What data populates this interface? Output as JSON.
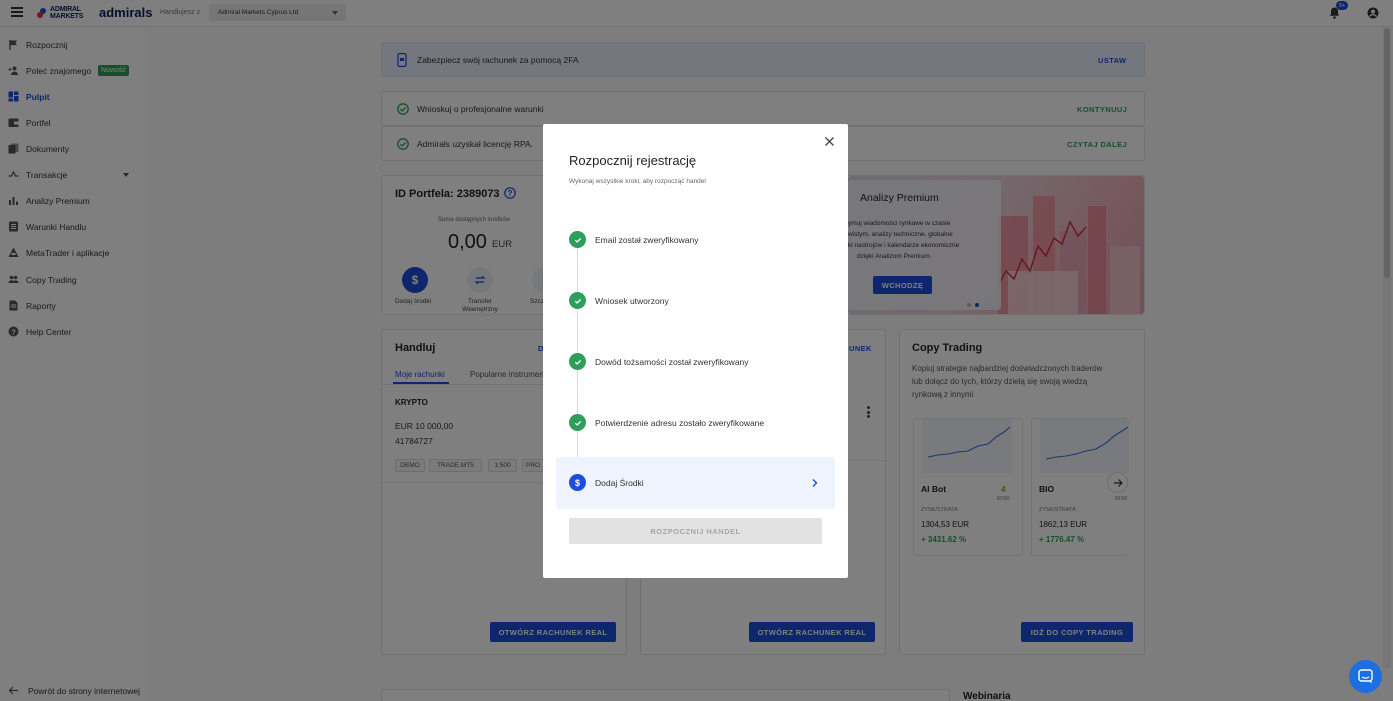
{
  "topbar": {
    "logo_line1": "ADMIRAL",
    "logo_line2": "MARKETS",
    "brand": "admirals",
    "trading_with_label": "Handlujesz z",
    "entity_select": "Admiral Markets Cyprus Ltd",
    "notification_count": "9+"
  },
  "sidebar": {
    "items": [
      {
        "label": "Rozpocznij",
        "icon": "flag-icon"
      },
      {
        "label": "Poleć znajomego",
        "icon": "add-person-icon",
        "badge": "Nowość"
      },
      {
        "label": "Pulpit",
        "icon": "dashboard-icon"
      },
      {
        "label": "Portfel",
        "icon": "wallet-icon"
      },
      {
        "label": "Dokumenty",
        "icon": "documents-icon"
      },
      {
        "label": "Transakcje",
        "icon": "transactions-icon"
      },
      {
        "label": "Analizy Premium",
        "icon": "bar-chart-icon"
      },
      {
        "label": "Warunki Handlu",
        "icon": "list-icon"
      },
      {
        "label": "MetaTrader i aplikacje",
        "icon": "platform-icon"
      },
      {
        "label": "Copy Trading",
        "icon": "people-icon"
      },
      {
        "label": "Raporty",
        "icon": "report-icon"
      },
      {
        "label": "Help Center",
        "icon": "help-icon"
      }
    ],
    "back_link": "Powrót do strony internetowej"
  },
  "alerts": {
    "twofa_text": "Zabezpiecz swój rachunek za pomocą 2FA",
    "twofa_action": "USTAW",
    "pro_text": "Wnioskuj o profesjonalne warunki",
    "pro_action": "KONTYNUUJ",
    "rpa_text": "Admirals uzyskał licencję RPA.",
    "rpa_action": "CZYTAJ DALEJ"
  },
  "portfolio": {
    "id_label": "ID Portfela: 2389073",
    "balance_caption": "Suma dostępnych środków",
    "balance": "0,00",
    "currency": "EUR",
    "actions": [
      "Dodaj środki",
      "Transfer Wewnętrzny",
      "Szcz"
    ]
  },
  "premium_banner": {
    "title": "Analizy Premium",
    "line1": "ymuj wiadomości rynkowe w czasie",
    "line2": "wistym, analizy techniczne, globalne",
    "line3": "ki nastrojów i kalendarze ekonomiczne",
    "line4": "dzięki Analizom Premium.",
    "button": "WCHODZĘ"
  },
  "trade": {
    "title": "Handluj",
    "tab_link": "D",
    "tabs": [
      "Moje rachunki",
      "Popularne instrumen"
    ],
    "account_type": "KRYPTO",
    "account_balance": "EUR 10 000,00",
    "account_number": "41784727",
    "tags": [
      "DEMO",
      "TRADE.MT5",
      "1:500",
      "PRO"
    ],
    "open_real_button": "OTWÓRZ RACHUNEK REAL"
  },
  "middle": {
    "link": "UNEK",
    "open_real_button": "OTWÓRZ RACHUNEK REAL"
  },
  "copy_trading": {
    "title": "Copy Trading",
    "description_line1": "Kopiuj strategie najbardziej doświadczonych traderów",
    "description_line2": "lub dołącz do tych, którzy dzielą się swoją wiedzą",
    "description_line3": "rynkową z innymi",
    "cards": [
      {
        "name": "AI Bot",
        "risk_value": "4",
        "risk_label": "RISK",
        "pl_label": "ZYSK/STRATA",
        "pl_value": "1304,53 EUR",
        "pct": "+ 3431.62 %"
      },
      {
        "name": "BIO",
        "risk_label": "RISK",
        "pl_label": "ZYSK/STRATA",
        "pl_value": "1862,13 EUR",
        "pct": "+ 1776.47 %"
      }
    ],
    "button": "IDŹ DO COPY TRADING"
  },
  "bottom": {
    "webinars": "Webinaria"
  },
  "modal": {
    "title": "Rozpocznij rejestrację",
    "subtitle": "Wykonaj wszystkie kroki, aby rozpocząć handel",
    "steps": [
      {
        "label": "Email został zweryfikowany",
        "status": "done"
      },
      {
        "label": "Wniosek utworzony",
        "status": "done"
      },
      {
        "label": "Dowód tożsamości został zweryfikowany",
        "status": "done"
      },
      {
        "label": "Potwierdzenie adresu zostało zweryfikowane",
        "status": "done"
      },
      {
        "label": "Dodaj Środki",
        "status": "current"
      }
    ],
    "start_button": "ROZPOCZNIJ HANDEL"
  },
  "colors": {
    "accent": "#1d4ed8",
    "success": "#2e9e5b"
  }
}
